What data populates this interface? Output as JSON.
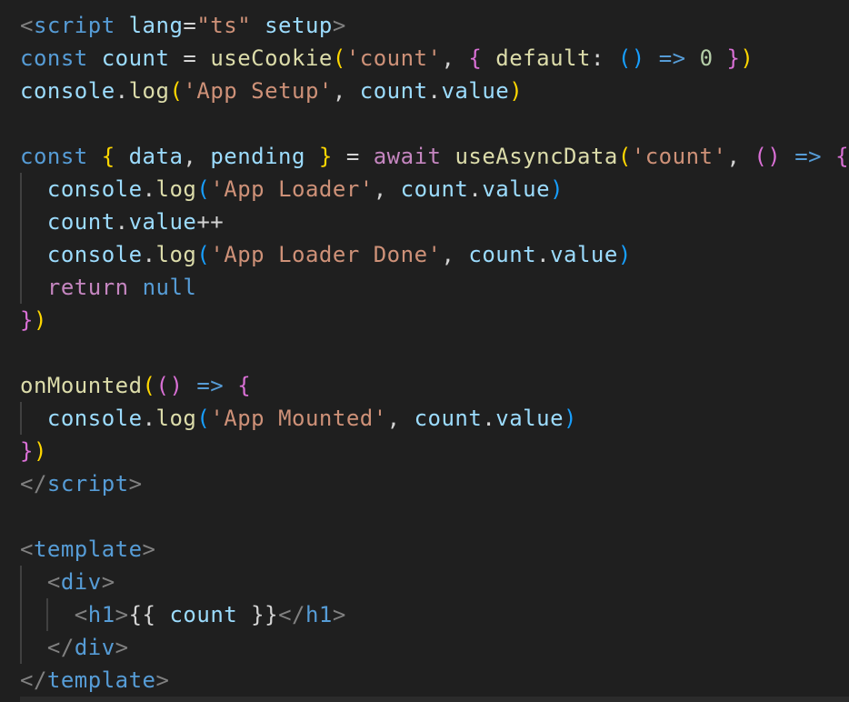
{
  "colors": {
    "background": "#1f1f1f",
    "default": "#d4d4d4",
    "tag": "#808080",
    "tagName": "#569cd6",
    "attr": "#9cdcfe",
    "string": "#ce9178",
    "keyword": "#569cd6",
    "variable": "#9cdcfe",
    "function": "#dcdcaa",
    "number": "#b5cea8",
    "control": "#c586c0",
    "bracket1": "#ffd700",
    "bracket2": "#da70d6",
    "bracket3": "#179fff",
    "plain": "#d4d4d4",
    "indentGuide": "#404040"
  },
  "code_lines": [
    [
      [
        "tag",
        "<"
      ],
      [
        "tagName",
        "script"
      ],
      [
        "plain",
        " "
      ],
      [
        "attr",
        "lang"
      ],
      [
        "plain",
        "="
      ],
      [
        "string",
        "\"ts\""
      ],
      [
        "plain",
        " "
      ],
      [
        "attr",
        "setup"
      ],
      [
        "tag",
        ">"
      ]
    ],
    [
      [
        "keyword",
        "const"
      ],
      [
        "plain",
        " "
      ],
      [
        "variable",
        "count"
      ],
      [
        "plain",
        " = "
      ],
      [
        "function",
        "useCookie"
      ],
      [
        "bracket1",
        "("
      ],
      [
        "string",
        "'count'"
      ],
      [
        "plain",
        ", "
      ],
      [
        "bracket2",
        "{"
      ],
      [
        "plain",
        " "
      ],
      [
        "function",
        "default"
      ],
      [
        "plain",
        ": "
      ],
      [
        "bracket3",
        "()"
      ],
      [
        "plain",
        " "
      ],
      [
        "keyword",
        "=>"
      ],
      [
        "plain",
        " "
      ],
      [
        "number",
        "0"
      ],
      [
        "plain",
        " "
      ],
      [
        "bracket2",
        "}"
      ],
      [
        "bracket1",
        ")"
      ]
    ],
    [
      [
        "variable",
        "console"
      ],
      [
        "plain",
        "."
      ],
      [
        "function",
        "log"
      ],
      [
        "bracket1",
        "("
      ],
      [
        "string",
        "'App Setup'"
      ],
      [
        "plain",
        ", "
      ],
      [
        "variable",
        "count"
      ],
      [
        "plain",
        "."
      ],
      [
        "variable",
        "value"
      ],
      [
        "bracket1",
        ")"
      ]
    ],
    [],
    [
      [
        "keyword",
        "const"
      ],
      [
        "plain",
        " "
      ],
      [
        "bracket1",
        "{"
      ],
      [
        "plain",
        " "
      ],
      [
        "variable",
        "data"
      ],
      [
        "plain",
        ", "
      ],
      [
        "variable",
        "pending"
      ],
      [
        "plain",
        " "
      ],
      [
        "bracket1",
        "}"
      ],
      [
        "plain",
        " = "
      ],
      [
        "control",
        "await"
      ],
      [
        "plain",
        " "
      ],
      [
        "function",
        "useAsyncData"
      ],
      [
        "bracket1",
        "("
      ],
      [
        "string",
        "'count'"
      ],
      [
        "plain",
        ", "
      ],
      [
        "bracket2",
        "()"
      ],
      [
        "plain",
        " "
      ],
      [
        "keyword",
        "=>"
      ],
      [
        "plain",
        " "
      ],
      [
        "bracket2",
        "{"
      ]
    ],
    [
      [
        "plain",
        "  "
      ],
      [
        "variable",
        "console"
      ],
      [
        "plain",
        "."
      ],
      [
        "function",
        "log"
      ],
      [
        "bracket3",
        "("
      ],
      [
        "string",
        "'App Loader'"
      ],
      [
        "plain",
        ", "
      ],
      [
        "variable",
        "count"
      ],
      [
        "plain",
        "."
      ],
      [
        "variable",
        "value"
      ],
      [
        "bracket3",
        ")"
      ]
    ],
    [
      [
        "plain",
        "  "
      ],
      [
        "variable",
        "count"
      ],
      [
        "plain",
        "."
      ],
      [
        "variable",
        "value"
      ],
      [
        "plain",
        "++"
      ]
    ],
    [
      [
        "plain",
        "  "
      ],
      [
        "variable",
        "console"
      ],
      [
        "plain",
        "."
      ],
      [
        "function",
        "log"
      ],
      [
        "bracket3",
        "("
      ],
      [
        "string",
        "'App Loader Done'"
      ],
      [
        "plain",
        ", "
      ],
      [
        "variable",
        "count"
      ],
      [
        "plain",
        "."
      ],
      [
        "variable",
        "value"
      ],
      [
        "bracket3",
        ")"
      ]
    ],
    [
      [
        "plain",
        "  "
      ],
      [
        "control",
        "return"
      ],
      [
        "plain",
        " "
      ],
      [
        "keyword",
        "null"
      ]
    ],
    [
      [
        "bracket2",
        "}"
      ],
      [
        "bracket1",
        ")"
      ]
    ],
    [],
    [
      [
        "function",
        "onMounted"
      ],
      [
        "bracket1",
        "("
      ],
      [
        "bracket2",
        "()"
      ],
      [
        "plain",
        " "
      ],
      [
        "keyword",
        "=>"
      ],
      [
        "plain",
        " "
      ],
      [
        "bracket2",
        "{"
      ]
    ],
    [
      [
        "plain",
        "  "
      ],
      [
        "variable",
        "console"
      ],
      [
        "plain",
        "."
      ],
      [
        "function",
        "log"
      ],
      [
        "bracket3",
        "("
      ],
      [
        "string",
        "'App Mounted'"
      ],
      [
        "plain",
        ", "
      ],
      [
        "variable",
        "count"
      ],
      [
        "plain",
        "."
      ],
      [
        "variable",
        "value"
      ],
      [
        "bracket3",
        ")"
      ]
    ],
    [
      [
        "bracket2",
        "}"
      ],
      [
        "bracket1",
        ")"
      ]
    ],
    [
      [
        "tag",
        "</"
      ],
      [
        "tagName",
        "script"
      ],
      [
        "tag",
        ">"
      ]
    ],
    [],
    [
      [
        "tag",
        "<"
      ],
      [
        "tagName",
        "template"
      ],
      [
        "tag",
        ">"
      ]
    ],
    [
      [
        "plain",
        "  "
      ],
      [
        "tag",
        "<"
      ],
      [
        "tagName",
        "div"
      ],
      [
        "tag",
        ">"
      ]
    ],
    [
      [
        "plain",
        "    "
      ],
      [
        "tag",
        "<"
      ],
      [
        "tagName",
        "h1"
      ],
      [
        "tag",
        ">"
      ],
      [
        "plain",
        "{{ "
      ],
      [
        "variable",
        "count"
      ],
      [
        "plain",
        " }}"
      ],
      [
        "tag",
        "</"
      ],
      [
        "tagName",
        "h1"
      ],
      [
        "tag",
        ">"
      ]
    ],
    [
      [
        "plain",
        "  "
      ],
      [
        "tag",
        "</"
      ],
      [
        "tagName",
        "div"
      ],
      [
        "tag",
        ">"
      ]
    ],
    [
      [
        "tag",
        "</"
      ],
      [
        "tagName",
        "template"
      ],
      [
        "tag",
        ">"
      ]
    ]
  ]
}
